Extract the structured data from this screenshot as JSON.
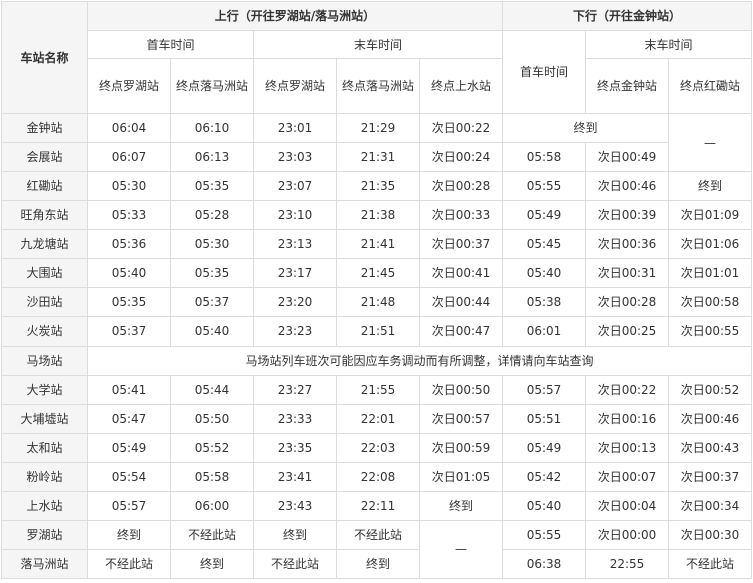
{
  "header": {
    "station_col": "车站名称",
    "up_direction": "上行（开往罗湖站/落马洲站）",
    "down_direction": "下行（开往金钟站）",
    "first_train": "首车时间",
    "last_train": "末车时间",
    "up_first_lowu": "终点罗湖站",
    "up_first_lmc": "终点落马洲站",
    "up_last_lowu": "终点罗湖站",
    "up_last_lmc": "终点落马洲站",
    "up_last_sheungshui": "终点上水站",
    "down_first": "首车时间",
    "down_last_admiralty": "终点金钟站",
    "down_last_hunghom": "终点红磡站"
  },
  "stations": [
    "金钟站",
    "会展站",
    "红磡站",
    "旺角东站",
    "九龙塘站",
    "大围站",
    "沙田站",
    "火炭站",
    "马场站",
    "大学站",
    "大埔墟站",
    "太和站",
    "粉岭站",
    "上水站",
    "罗湖站",
    "落马洲站"
  ],
  "rows": {
    "admiralty": [
      "06:04",
      "06:10",
      "23:01",
      "21:29",
      "次日00:22",
      "终到"
    ],
    "exhibition": [
      "06:07",
      "06:13",
      "23:03",
      "21:31",
      "次日00:24",
      "05:58",
      "次日00:49"
    ],
    "hunghom": [
      "05:30",
      "05:35",
      "23:07",
      "21:35",
      "次日00:28",
      "05:55",
      "次日00:46",
      "终到"
    ],
    "mongkokeast": [
      "05:33",
      "05:28",
      "23:10",
      "21:38",
      "次日00:33",
      "05:49",
      "次日00:39",
      "次日01:09"
    ],
    "kowloontong": [
      "05:36",
      "05:30",
      "23:13",
      "21:41",
      "次日00:37",
      "05:45",
      "次日00:36",
      "次日01:06"
    ],
    "taiwai": [
      "05:40",
      "05:35",
      "23:17",
      "21:45",
      "次日00:41",
      "05:40",
      "次日00:31",
      "次日01:01"
    ],
    "shatin": [
      "05:35",
      "05:37",
      "23:20",
      "21:48",
      "次日00:44",
      "05:38",
      "次日00:28",
      "次日00:58"
    ],
    "fotan": [
      "05:37",
      "05:40",
      "23:23",
      "21:51",
      "次日00:47",
      "06:01",
      "次日00:25",
      "次日00:55"
    ],
    "university": [
      "05:41",
      "05:44",
      "23:27",
      "21:55",
      "次日00:50",
      "05:57",
      "次日00:22",
      "次日00:52"
    ],
    "taipomarket": [
      "05:47",
      "05:50",
      "23:33",
      "22:01",
      "次日00:57",
      "05:51",
      "次日00:16",
      "次日00:46"
    ],
    "taiwo": [
      "05:49",
      "05:52",
      "23:35",
      "22:03",
      "次日00:59",
      "05:49",
      "次日00:13",
      "次日00:43"
    ],
    "fanling": [
      "05:54",
      "05:58",
      "23:41",
      "22:08",
      "次日01:05",
      "05:42",
      "次日00:07",
      "次日00:37"
    ],
    "sheungshui": [
      "05:57",
      "06:00",
      "23:43",
      "22:11",
      "终到",
      "05:40",
      "次日00:04",
      "次日00:34"
    ],
    "lowu": [
      "终到",
      "不经此站",
      "终到",
      "不经此站",
      "05:55",
      "次日00:00",
      "次日00:30"
    ],
    "lokmachau": [
      "不经此站",
      "终到",
      "不经此站",
      "终到",
      "06:38",
      "22:55",
      "不经此站"
    ]
  },
  "dash": "—",
  "racecourse_note": "马场站列车班次可能因应车务调动而有所调整，详情请向车站查询"
}
